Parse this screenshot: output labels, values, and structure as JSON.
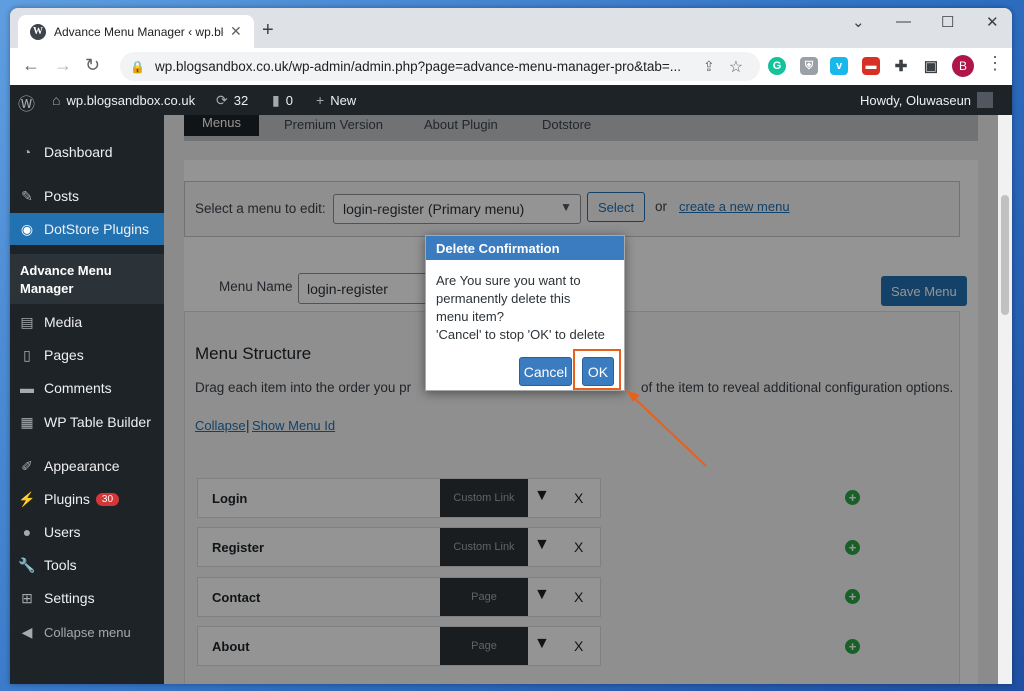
{
  "browser": {
    "tab_title": "Advance Menu Manager ‹ wp.blo",
    "tab_favicon_letter": "W",
    "url": "wp.blogsandbox.co.uk/wp-admin/admin.php?page=advance-menu-manager-pro&tab=...",
    "profile_initial": "B",
    "icons": [
      "back-icon",
      "forward-icon",
      "reload-icon",
      "lock-icon",
      "share-icon",
      "star-icon",
      "grammarly-icon",
      "shield-icon",
      "vimeo-icon",
      "extension-red-icon",
      "puzzle-icon",
      "sidepanel-icon",
      "menu-dots-icon"
    ]
  },
  "adminbar": {
    "site": "wp.blogsandbox.co.uk",
    "updates": "32",
    "comments": "0",
    "new": "New",
    "howdy": "Howdy, Oluwaseun"
  },
  "sidebar": {
    "items": [
      {
        "label": "Dashboard",
        "icon": "dashboard-icon"
      },
      {
        "label": "Posts",
        "icon": "pin-icon"
      },
      {
        "label": "DotStore Plugins",
        "icon": "dotstore-icon"
      },
      {
        "label": "Media",
        "icon": "media-icon"
      },
      {
        "label": "Pages",
        "icon": "pages-icon"
      },
      {
        "label": "Comments",
        "icon": "comments-icon"
      },
      {
        "label": "WP Table Builder",
        "icon": "table-icon"
      },
      {
        "label": "Appearance",
        "icon": "brush-icon"
      },
      {
        "label": "Plugins",
        "icon": "plug-icon"
      },
      {
        "label": "Users",
        "icon": "users-icon"
      },
      {
        "label": "Tools",
        "icon": "wrench-icon"
      },
      {
        "label": "Settings",
        "icon": "settings-icon"
      },
      {
        "label": "Collapse menu",
        "icon": "collapse-icon"
      }
    ],
    "submenu_label": "Advance Menu Manager",
    "plugins_badge": "30"
  },
  "main": {
    "tabs": [
      "Menus",
      "Premium Version",
      "About Plugin",
      "Dotstore"
    ],
    "select_label": "Select a menu to edit:",
    "select_value": "login-register (Primary menu)",
    "select_button": "Select",
    "or_text": "or",
    "create_link": "create a new menu",
    "menu_name_label": "Menu Name",
    "menu_name_value": "login-register",
    "save_button": "Save Menu",
    "structure_title": "Menu Structure",
    "drag_text_left": "Drag each item into the order you pr",
    "drag_text_right": "of the item to reveal additional configuration options.",
    "collapse_link": "Collapse",
    "separator": "|",
    "show_id_link": "Show Menu Id",
    "items": [
      {
        "label": "Login",
        "type": "Custom Link"
      },
      {
        "label": "Register",
        "type": "Custom Link"
      },
      {
        "label": "Contact",
        "type": "Page"
      },
      {
        "label": "About",
        "type": "Page"
      }
    ],
    "remove_symbol": "X",
    "add_symbol": "+"
  },
  "dialog": {
    "title": "Delete Confirmation",
    "line1": "Are You sure you want to",
    "line2": "permanently delete this",
    "line3": "menu item?",
    "line4": "'Cancel' to stop 'OK' to delete",
    "cancel": "Cancel",
    "ok": "OK"
  },
  "colors": {
    "wp_dark": "#1d2327",
    "wp_blue": "#2271b1",
    "dialog_blue": "#3b7bc0",
    "highlight_orange": "#e8611a",
    "add_green": "#28a745"
  }
}
